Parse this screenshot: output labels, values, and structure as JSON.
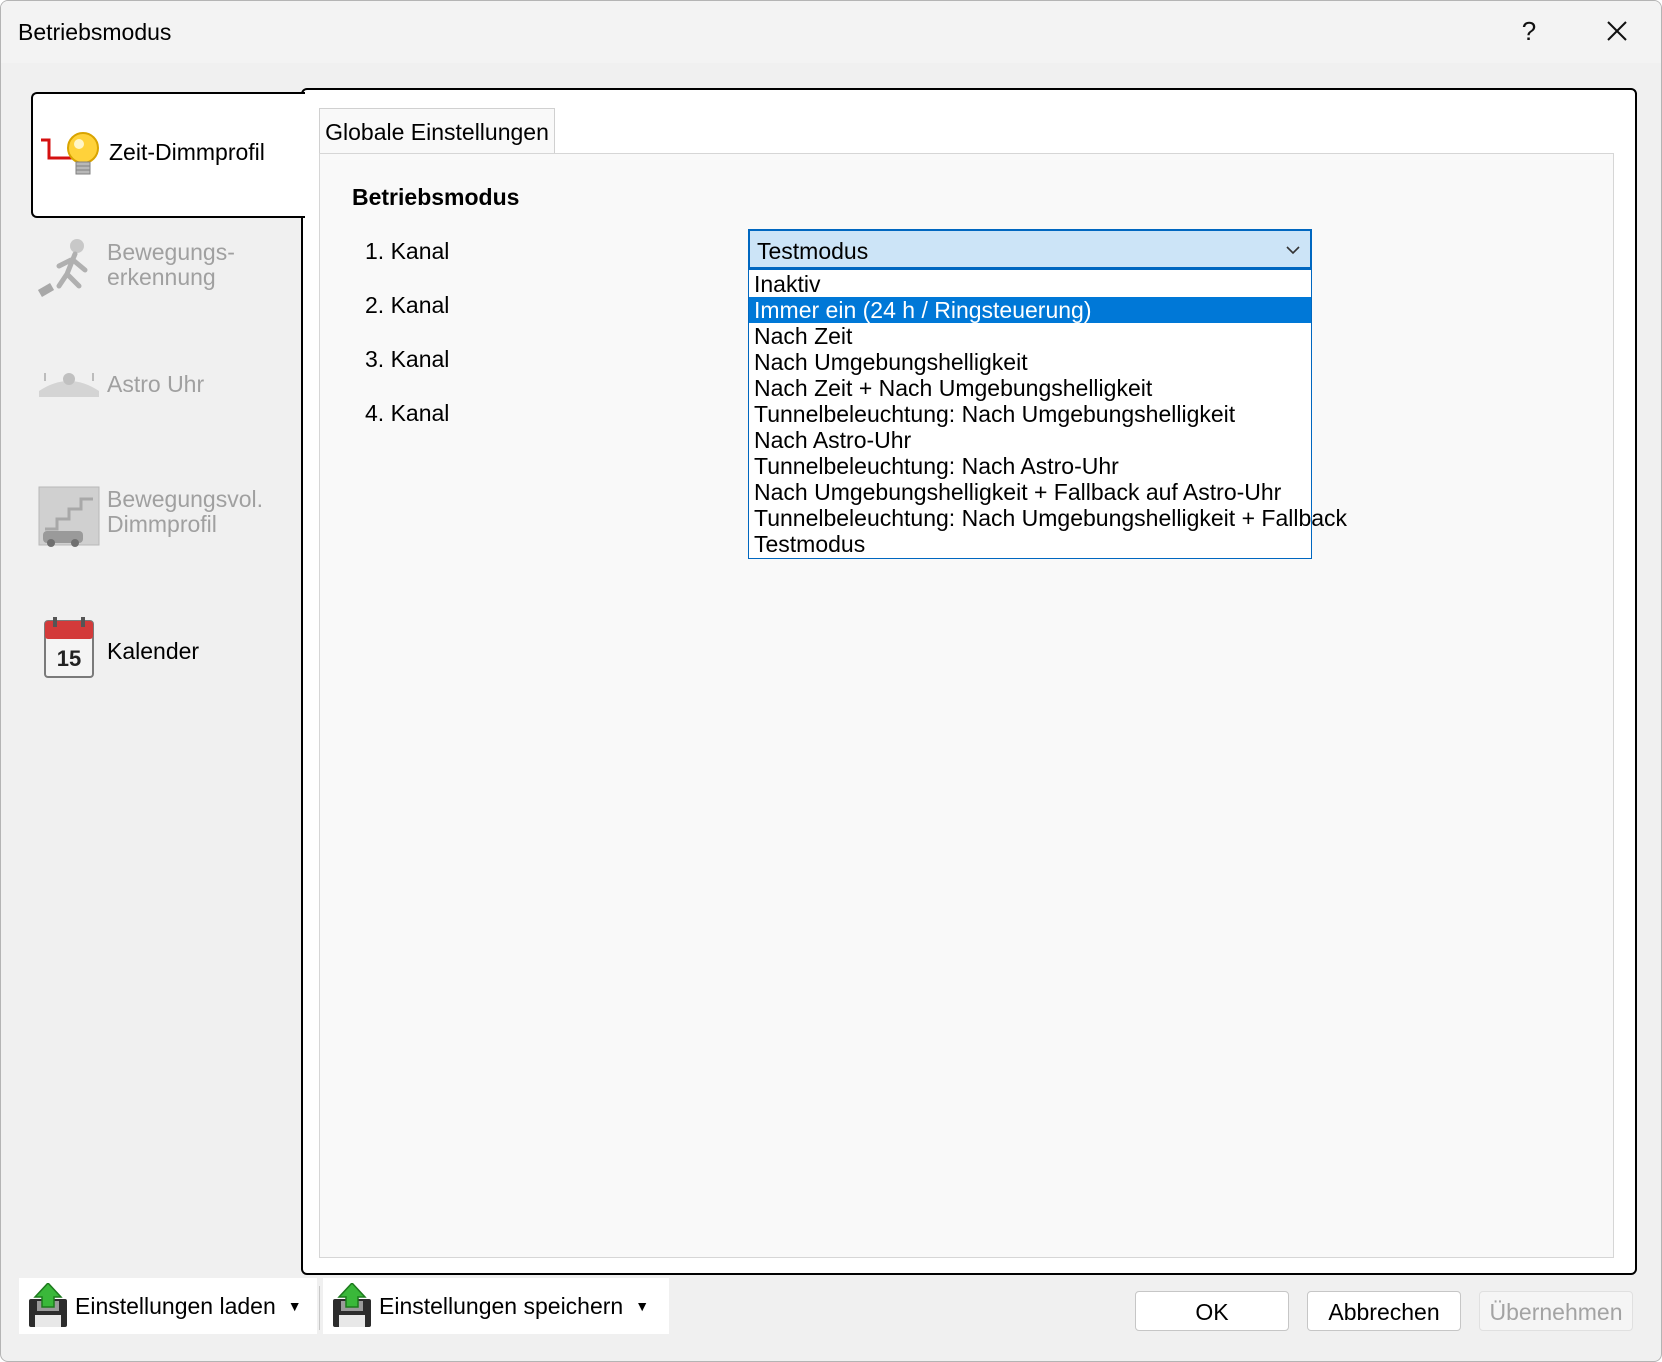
{
  "window": {
    "title": "Betriebsmodus",
    "help_label": "?"
  },
  "nav": {
    "items": [
      {
        "label": "Zeit-Dimmprofil",
        "active": true,
        "enabled": true
      },
      {
        "label": "Bewegungs-\nerkennung",
        "active": false,
        "enabled": false
      },
      {
        "label": "Astro Uhr",
        "active": false,
        "enabled": false
      },
      {
        "label": "Bewegungsvol.\nDimmprofil",
        "active": false,
        "enabled": false
      },
      {
        "label": "Kalender",
        "active": false,
        "enabled": true
      }
    ],
    "calendar_day": "15"
  },
  "main": {
    "tab_label": "Globale Einstellungen",
    "section_title": "Betriebsmodus",
    "channels": [
      "1. Kanal",
      "2. Kanal",
      "3. Kanal",
      "4. Kanal"
    ],
    "combo": {
      "value": "Testmodus",
      "highlighted_option": "Immer ein (24 h / Ringsteuerung)",
      "options": [
        "Inaktiv",
        "Immer ein (24 h / Ringsteuerung)",
        "Nach Zeit",
        "Nach Umgebungshelligkeit",
        "Nach Zeit + Nach Umgebungshelligkeit",
        "Tunnelbeleuchtung: Nach Umgebungshelligkeit",
        "Nach Astro-Uhr",
        "Tunnelbeleuchtung: Nach Astro-Uhr",
        "Nach Umgebungshelligkeit + Fallback auf Astro-Uhr",
        "Tunnelbeleuchtung: Nach Umgebungshelligkeit + Fallback",
        "Testmodus"
      ]
    }
  },
  "footer": {
    "load_label": "Einstellungen laden",
    "save_label": "Einstellungen speichern",
    "ok_label": "OK",
    "cancel_label": "Abbrechen",
    "apply_label": "Übernehmen",
    "apply_enabled": false
  },
  "colors": {
    "accent": "#0078d7",
    "combo_fill": "#cce4f7",
    "disabled_text": "#a0a0a0"
  }
}
